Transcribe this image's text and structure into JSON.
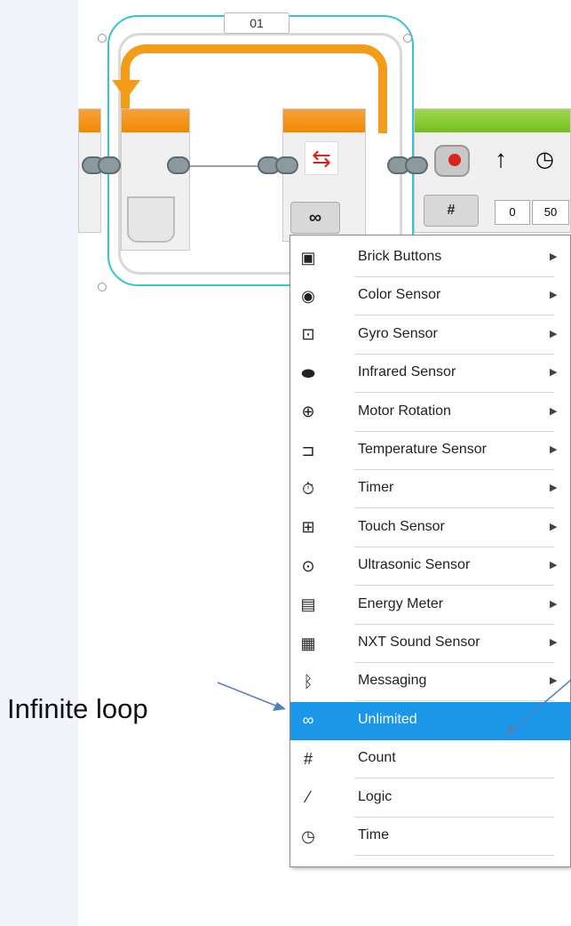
{
  "loop": {
    "label": "01"
  },
  "move_block": {
    "port_values": [
      "0",
      "50"
    ]
  },
  "mode_button": {
    "symbol": "∞"
  },
  "loop_count_symbol": "#",
  "menu": {
    "items": [
      {
        "label": "Brick Buttons",
        "icon": "brick-buttons-icon",
        "glyph": "▣",
        "submenu": true
      },
      {
        "label": "Color Sensor",
        "icon": "color-sensor-icon",
        "glyph": "◉",
        "submenu": true
      },
      {
        "label": "Gyro Sensor",
        "icon": "gyro-sensor-icon",
        "glyph": "⊡",
        "submenu": true
      },
      {
        "label": "Infrared Sensor",
        "icon": "infrared-sensor-icon",
        "glyph": "⬬",
        "submenu": true
      },
      {
        "label": "Motor Rotation",
        "icon": "motor-rotation-icon",
        "glyph": "⊕",
        "submenu": true
      },
      {
        "label": "Temperature Sensor",
        "icon": "temperature-sensor-icon",
        "glyph": "⊐",
        "submenu": true
      },
      {
        "label": "Timer",
        "icon": "timer-icon",
        "glyph": "⏱",
        "submenu": true
      },
      {
        "label": "Touch Sensor",
        "icon": "touch-sensor-icon",
        "glyph": "⊞",
        "submenu": true
      },
      {
        "label": "Ultrasonic Sensor",
        "icon": "ultrasonic-sensor-icon",
        "glyph": "⊙",
        "submenu": true
      },
      {
        "label": "Energy Meter",
        "icon": "energy-meter-icon",
        "glyph": "▤",
        "submenu": true
      },
      {
        "label": "NXT Sound Sensor",
        "icon": "nxt-sound-sensor-icon",
        "glyph": "▦",
        "submenu": true
      },
      {
        "label": "Messaging",
        "icon": "messaging-icon",
        "glyph": "ᛒ",
        "submenu": true
      },
      {
        "label": "Unlimited",
        "icon": "infinity-icon",
        "glyph": "∞",
        "submenu": false,
        "selected": true
      },
      {
        "label": "Count",
        "icon": "count-icon",
        "glyph": "#",
        "submenu": false
      },
      {
        "label": "Logic",
        "icon": "logic-icon",
        "glyph": "⁄",
        "submenu": false
      },
      {
        "label": "Time",
        "icon": "time-icon",
        "glyph": "◷",
        "submenu": false
      }
    ],
    "submenu_arrow": "▶"
  },
  "annotation": {
    "text": "Infinite loop"
  },
  "colors": {
    "selection": "#1a97e8",
    "loop_frame": "#34c6d4",
    "loop_arrow": "#f39c17",
    "move_block_top": "#76bd21",
    "annotation_arrow": "#4f81bd"
  }
}
